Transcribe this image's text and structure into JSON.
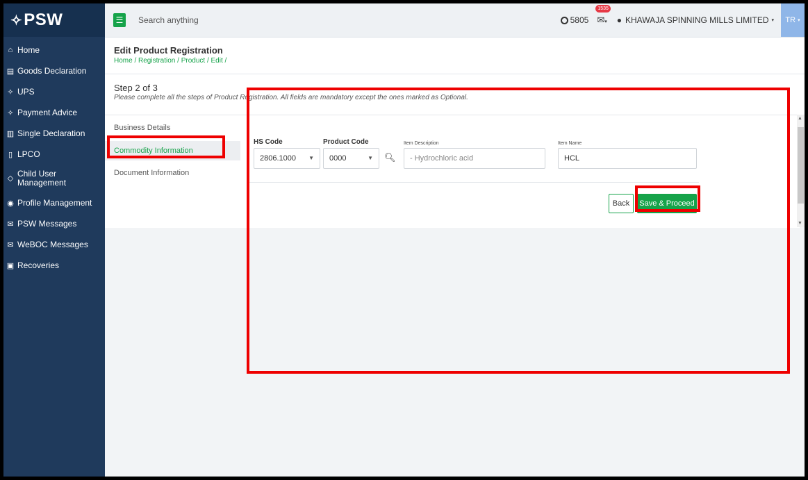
{
  "sidebar": {
    "logo": "PSW",
    "logo_mark": "✧",
    "items": [
      {
        "label": "Home",
        "icon": "home-icon"
      },
      {
        "label": "Goods Declaration",
        "icon": "document-icon"
      },
      {
        "label": "UPS",
        "icon": "diamond-icon"
      },
      {
        "label": "Payment Advice",
        "icon": "diamond-icon"
      },
      {
        "label": "Single Declaration",
        "icon": "building-icon"
      },
      {
        "label": "LPCO",
        "icon": "file-icon"
      },
      {
        "label": "Child User Management",
        "label_line1": "Child User",
        "label_line2": "Management",
        "icon": "user-tag-icon"
      },
      {
        "label": "Profile Management",
        "icon": "profile-icon"
      },
      {
        "label": "PSW Messages",
        "icon": "messages-icon"
      },
      {
        "label": "WeBOC Messages",
        "icon": "mail-icon"
      },
      {
        "label": "Recoveries",
        "icon": "clipboard-icon"
      }
    ]
  },
  "topbar": {
    "search_placeholder": "Search anything",
    "points": "5805",
    "mail_badge": "1535",
    "user_name": "KHAWAJA SPINNING MILLS LIMITED",
    "user_initials": "TR"
  },
  "page": {
    "title": "Edit Product Registration",
    "breadcrumb": "Home / Registration / Product / Edit /"
  },
  "step": {
    "title": "Step 2 of 3",
    "note": "Please complete all the steps of Product Registration. All fields are mandatory except the ones marked as Optional.",
    "links": [
      "Business Details",
      "Commodity Information",
      "Document Information"
    ],
    "active_index": 1
  },
  "form": {
    "hs_code_label": "HS Code",
    "hs_code_value": "2806.1000",
    "product_code_label": "Product Code",
    "product_code_value": "0000",
    "item_description_label": "Item Description",
    "item_description_value": "- Hydrochloric acid",
    "item_name_label": "Item Name",
    "item_name_value": "HCL",
    "back_label": "Back",
    "save_label": "Save & Proceed"
  },
  "colors": {
    "sidebar_bg": "#1f3a5c",
    "accent_green": "#16a34a",
    "highlight_red": "#e00000"
  }
}
